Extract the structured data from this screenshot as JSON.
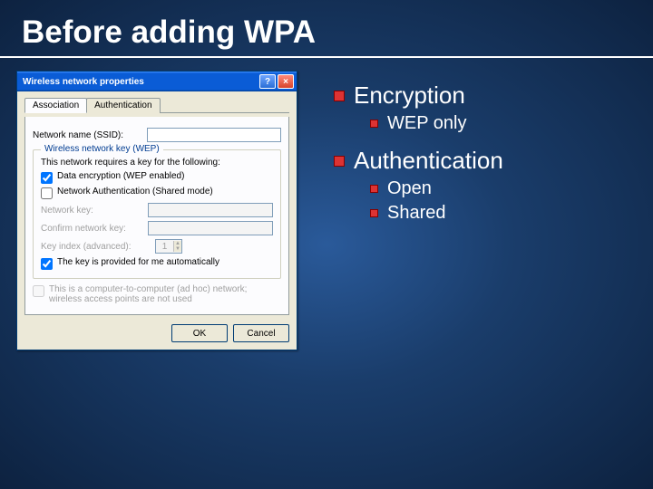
{
  "slide": {
    "title": "Before adding WPA"
  },
  "dialog": {
    "title": "Wireless network properties",
    "help_label": "?",
    "close_label": "×",
    "tabs": {
      "assoc": "Association",
      "auth": "Authentication"
    },
    "ssid_label": "Network name (SSID):",
    "ssid_value": "",
    "group_caption": "Wireless network key (WEP)",
    "group_text": "This network requires a key for the following:",
    "chk_data_enc": "Data encryption (WEP enabled)",
    "chk_net_auth": "Network Authentication (Shared mode)",
    "netkey_label": "Network key:",
    "confirm_label": "Confirm network key:",
    "key_index_label": "Key index (advanced):",
    "key_index_value": "1",
    "chk_auto": "The key is provided for me automatically",
    "chk_adhoc": "This is a computer-to-computer (ad hoc) network; wireless access points are not used",
    "ok": "OK",
    "cancel": "Cancel"
  },
  "bullets": {
    "encryption": "Encryption",
    "wep_only": "WEP only",
    "authentication": "Authentication",
    "open": "Open",
    "shared": "Shared"
  }
}
